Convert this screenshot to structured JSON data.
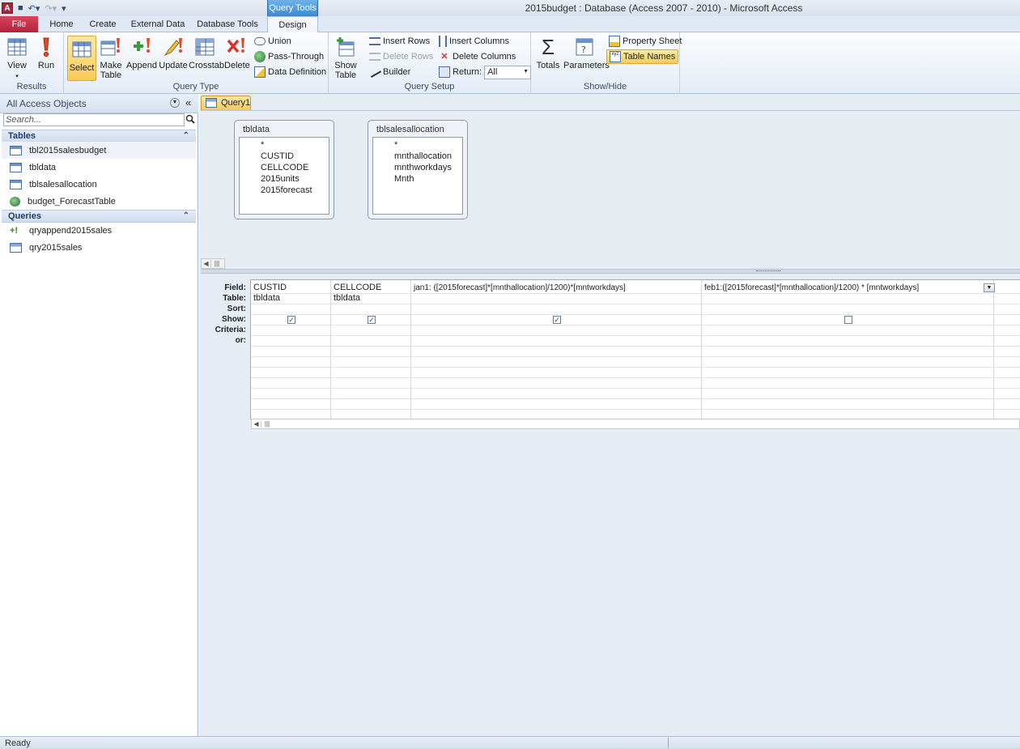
{
  "window": {
    "title": "2015budget : Database (Access 2007 - 2010)  -  Microsoft Access"
  },
  "ribbon": {
    "context_tab": "Query Tools",
    "tabs": [
      "File",
      "Home",
      "Create",
      "External Data",
      "Database Tools",
      "Design"
    ],
    "groups": {
      "results": {
        "label": "Results",
        "view": "View",
        "run": "Run"
      },
      "query_type": {
        "label": "Query Type",
        "select": "Select",
        "make_table": "Make Table",
        "append": "Append",
        "update": "Update",
        "crosstab": "Crosstab",
        "delete": "Delete",
        "union": "Union",
        "pass_through": "Pass-Through",
        "data_definition": "Data Definition"
      },
      "query_setup": {
        "label": "Query Setup",
        "show_table": "Show Table",
        "insert_rows": "Insert Rows",
        "delete_rows": "Delete Rows",
        "builder": "Builder",
        "insert_columns": "Insert Columns",
        "delete_columns": "Delete Columns",
        "return_label": "Return:",
        "return_value": "All"
      },
      "show_hide": {
        "label": "Show/Hide",
        "totals": "Totals",
        "parameters": "Parameters",
        "property_sheet": "Property Sheet",
        "table_names": "Table Names"
      }
    }
  },
  "nav": {
    "header": "All Access Objects",
    "search_placeholder": "Search...",
    "tables_label": "Tables",
    "tables": [
      "tbl2015salesbudget",
      "tbldata",
      "tblsalesallocation",
      "budget_ForecastTable"
    ],
    "queries_label": "Queries",
    "queries": [
      "qryappend2015sales",
      "qry2015sales"
    ]
  },
  "document": {
    "tab": "Query1"
  },
  "tables_pane": [
    {
      "name": "tbldata",
      "fields": [
        "*",
        "CUSTID",
        "CELLCODE",
        "2015units",
        "2015forecast"
      ]
    },
    {
      "name": "tblsalesallocation",
      "fields": [
        "*",
        "mnthallocation",
        "mnthworkdays",
        "Mnth"
      ]
    }
  ],
  "grid": {
    "row_labels": [
      "Field:",
      "Table:",
      "Sort:",
      "Show:",
      "Criteria:",
      "or:"
    ],
    "columns": [
      {
        "field": "CUSTID",
        "table": "tbldata",
        "show": true
      },
      {
        "field": "CELLCODE",
        "table": "tbldata",
        "show": true
      },
      {
        "field": "jan1: ([2015forecast]*[mnthallocation]/1200)*[mntworkdays]",
        "table": "",
        "show": true
      },
      {
        "field": "feb1:([2015forecast]*[mnthallocation]/1200) * [mntworkdays]",
        "table": "",
        "show": false
      }
    ]
  },
  "status": {
    "text": "Ready"
  },
  "colors": {
    "file_tab": "#b3223c",
    "selected": "#f8cc54",
    "context_tab": "#3c8ad2"
  }
}
